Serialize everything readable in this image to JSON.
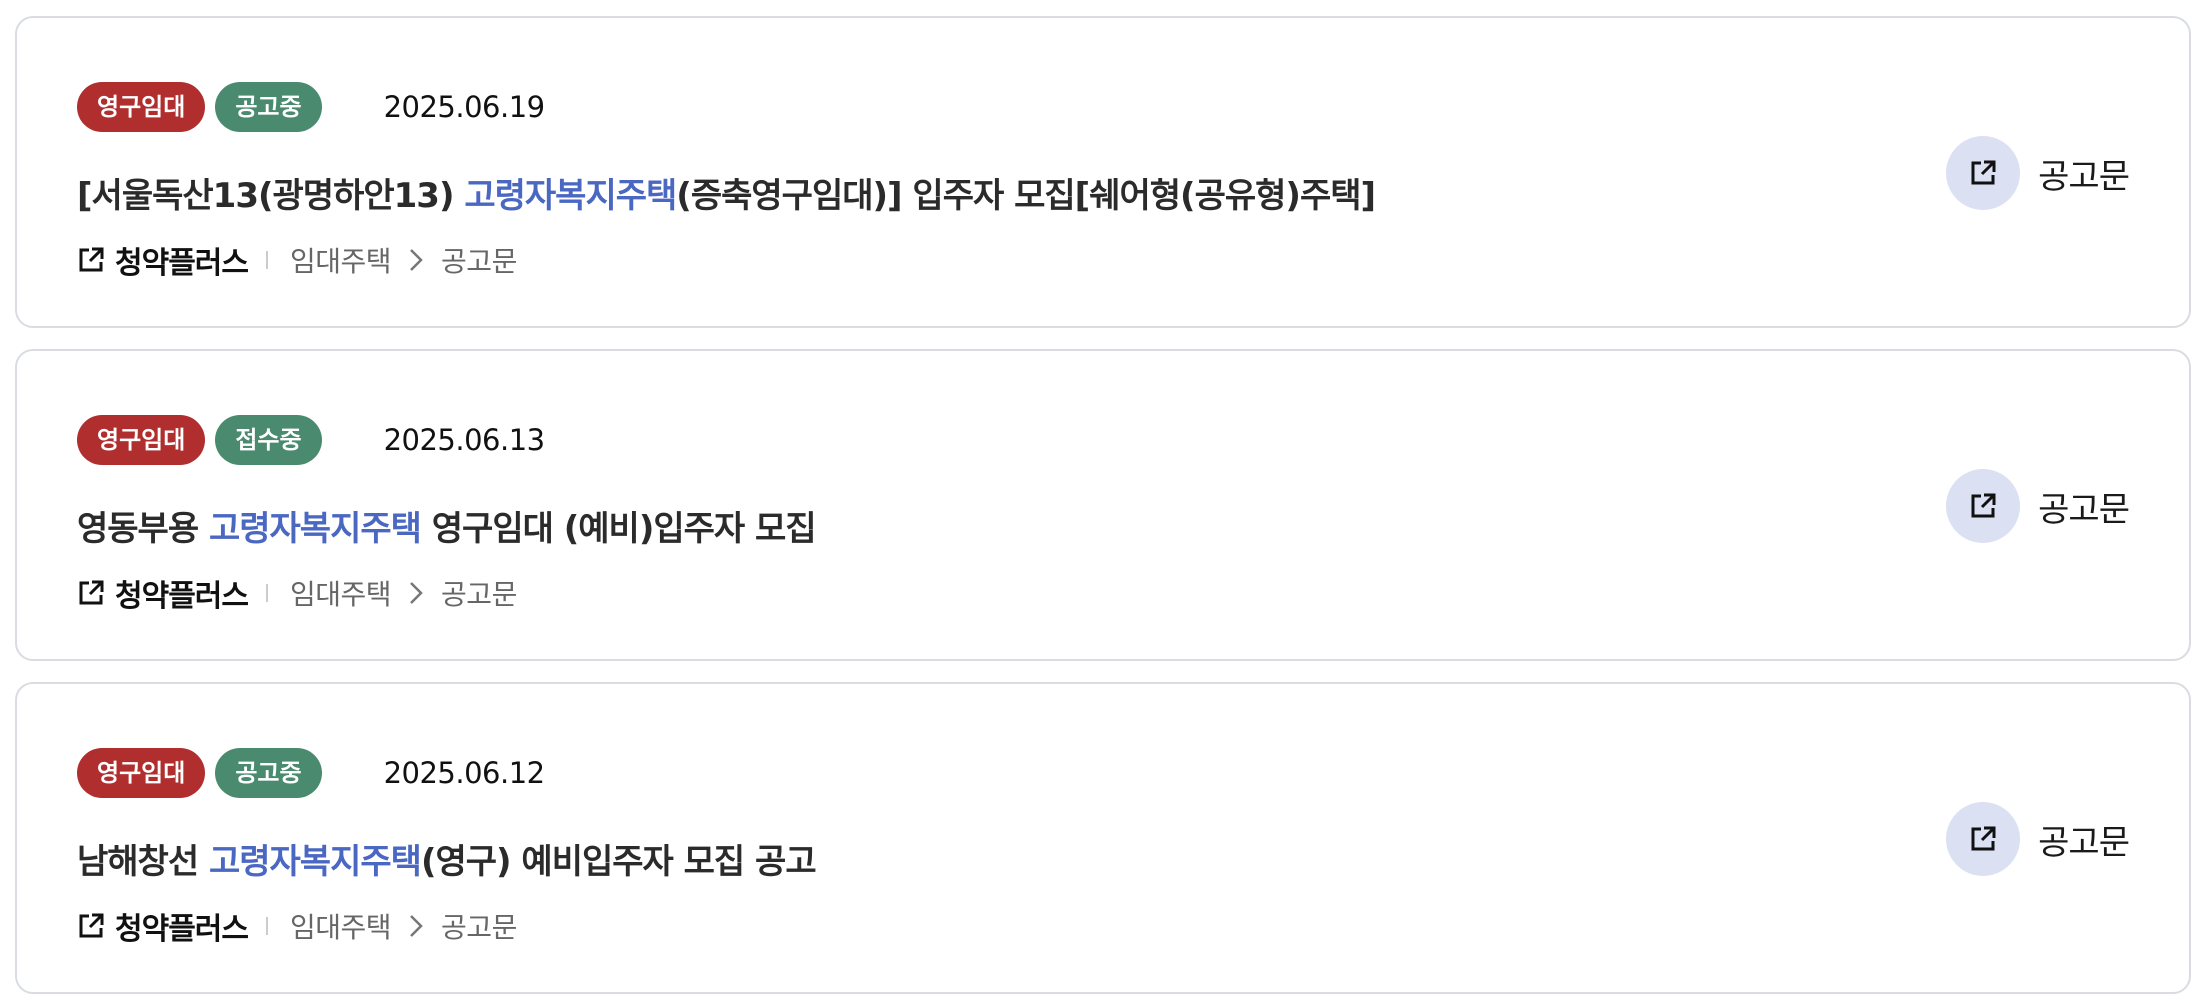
{
  "items": [
    {
      "type_badge": "영구임대",
      "status_badge": "공고중",
      "date": "2025.06.19",
      "title_pre": "[서울독산13(광명하안13) ",
      "title_hl": "고령자복지주택",
      "title_post": "(증축영구임대)] 입주자 모집[쉐어형(공유형)주택]",
      "source": "청약플러스",
      "crumb_category": "임대주택",
      "crumb_page": "공고문",
      "notice_label": "공고문"
    },
    {
      "type_badge": "영구임대",
      "status_badge": "접수중",
      "date": "2025.06.13",
      "title_pre": "영동부용 ",
      "title_hl": "고령자복지주택",
      "title_post": " 영구임대 (예비)입주자 모집",
      "source": "청약플러스",
      "crumb_category": "임대주택",
      "crumb_page": "공고문",
      "notice_label": "공고문"
    },
    {
      "type_badge": "영구임대",
      "status_badge": "공고중",
      "date": "2025.06.12",
      "title_pre": "남해창선 ",
      "title_hl": "고령자복지주택",
      "title_post": "(영구) 예비입주자 모집 공고",
      "source": "청약플러스",
      "crumb_category": "임대주택",
      "crumb_page": "공고문",
      "notice_label": "공고문"
    }
  ],
  "colors": {
    "type_badge": "#b02e2e",
    "status_badge": "#4a8a6f",
    "highlight": "#4a67c2",
    "icon_circle": "#dbe0f3"
  },
  "icons": {
    "external_link": "external-link-icon",
    "chevron": "chevron-right-icon"
  }
}
